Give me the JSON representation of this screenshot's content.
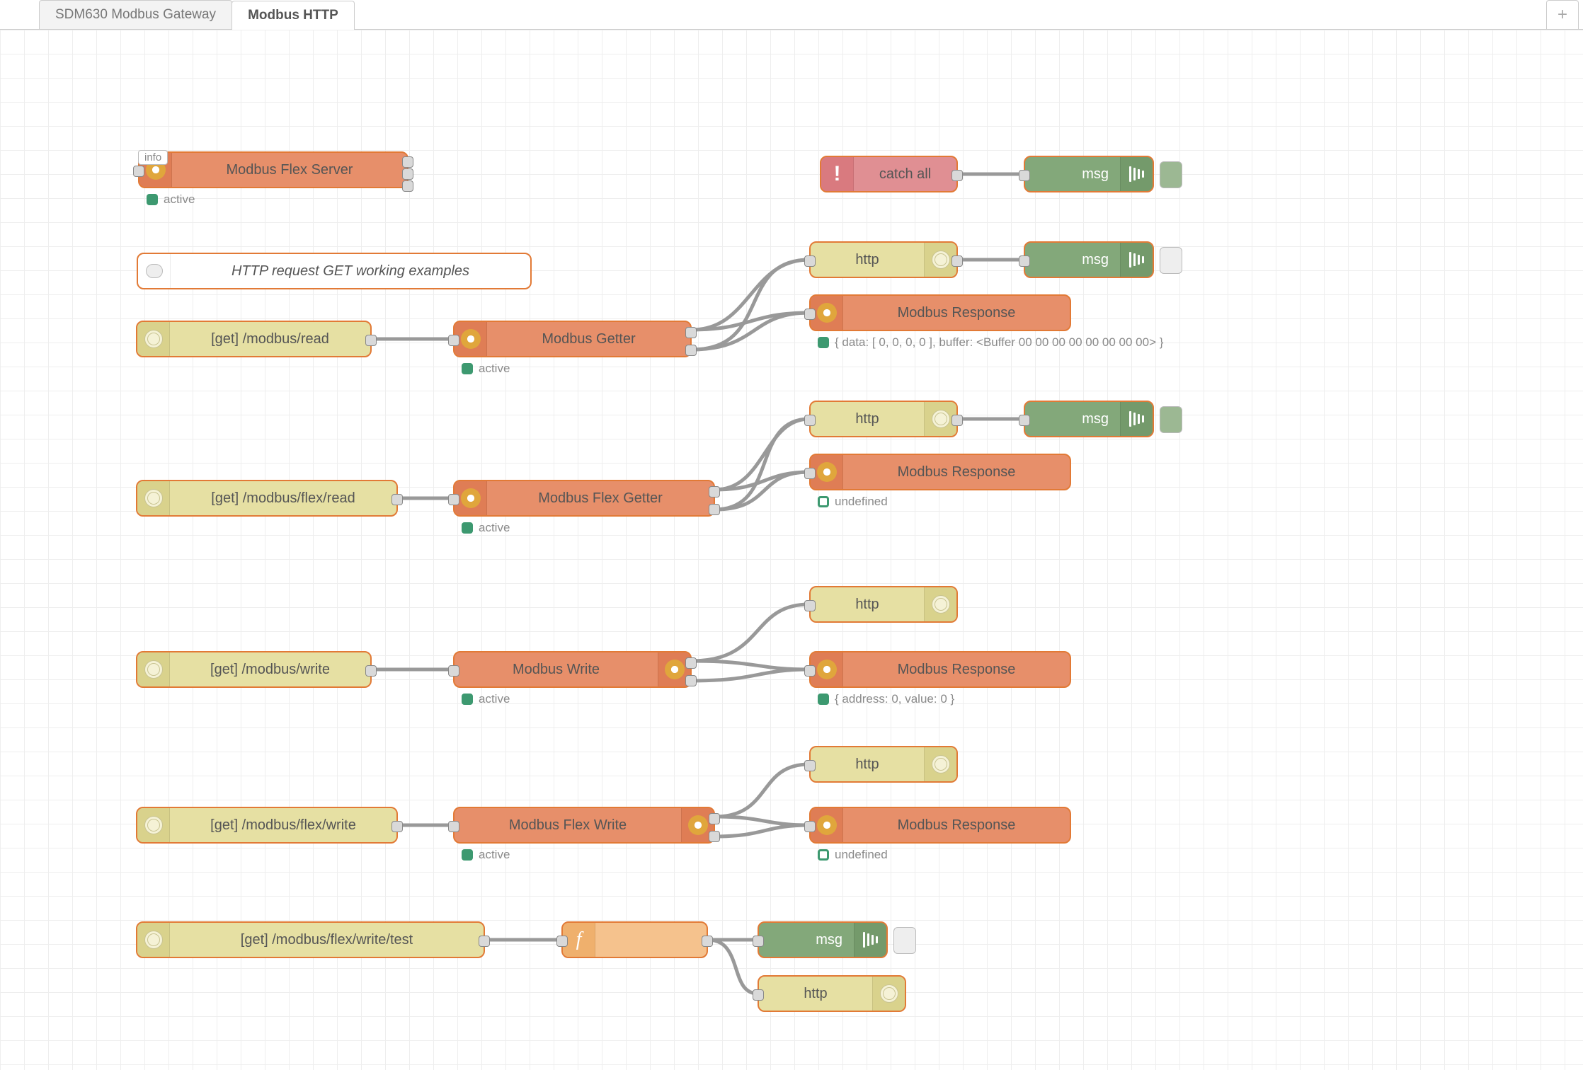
{
  "tabs": {
    "inactive": "SDM630 Modbus Gateway",
    "active": "Modbus HTTP"
  },
  "badges": {
    "info": "info"
  },
  "status": {
    "active": "active",
    "undefined": "undefined",
    "resp_data": "{ data: [ 0, 0, 0, 0 ], buffer: <Buffer 00 00 00 00 00 00 00 00> }",
    "resp_addr": "{ address: 0, value: 0 }"
  },
  "nodes": {
    "flexserver": "Modbus Flex Server",
    "catch": "catch all",
    "msg": "msg",
    "comment": "HTTP request GET working examples",
    "get_read": "[get] /modbus/read",
    "getter": "Modbus Getter",
    "http": "http",
    "modresp": "Modbus Response",
    "get_flex_read": "[get] /modbus/flex/read",
    "flexgetter": "Modbus Flex Getter",
    "get_write": "[get] /modbus/write",
    "modwrite": "Modbus Write",
    "get_flex_write": "[get] /modbus/flex/write",
    "flexwrite": "Modbus Flex Write",
    "get_flex_write_test": "[get] /modbus/flex/write/test"
  }
}
